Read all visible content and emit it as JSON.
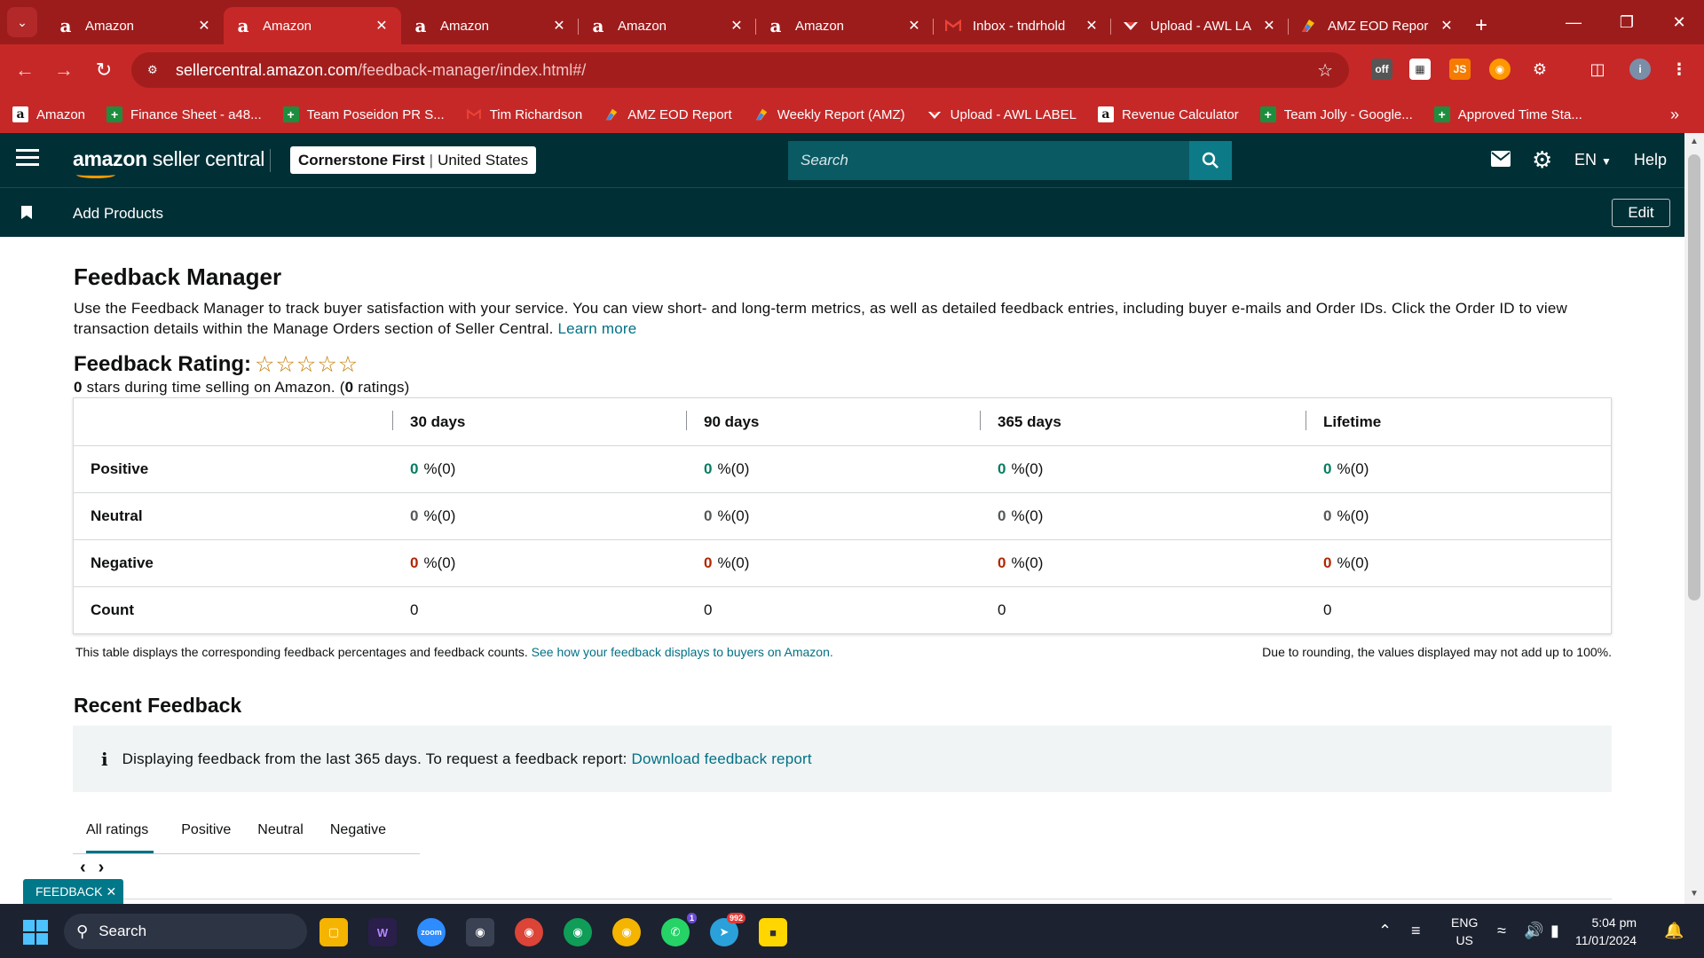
{
  "browser": {
    "tabs": [
      {
        "title": "Amazon",
        "icon": "amazon-icon",
        "active": false
      },
      {
        "title": "Amazon",
        "icon": "amazon-icon",
        "active": true
      },
      {
        "title": "Amazon",
        "icon": "amazon-icon",
        "active": false
      },
      {
        "title": "Amazon",
        "icon": "amazon-icon",
        "active": false
      },
      {
        "title": "Amazon",
        "icon": "amazon-icon",
        "active": false
      },
      {
        "title": "Inbox - tndrhold",
        "icon": "gmail-icon",
        "active": false
      },
      {
        "title": "Upload - AWL LA",
        "icon": "upload-icon",
        "active": false
      },
      {
        "title": "AMZ EOD Repor",
        "icon": "eod-report-icon",
        "active": false
      }
    ],
    "url_host": "sellercentral.amazon.com",
    "url_path": "/feedback-manager/index.html#/",
    "bookmarks": [
      {
        "label": "Amazon",
        "icon": "amazon-icon"
      },
      {
        "label": "Finance Sheet - a48...",
        "icon": "sheets-icon"
      },
      {
        "label": "Team Poseidon PR S...",
        "icon": "sheets-icon"
      },
      {
        "label": "Tim Richardson",
        "icon": "gmail-icon"
      },
      {
        "label": "AMZ EOD Report",
        "icon": "eod-report-icon"
      },
      {
        "label": "Weekly Report (AMZ)",
        "icon": "eod-report-icon"
      },
      {
        "label": "Upload - AWL LABEL",
        "icon": "upload-icon"
      },
      {
        "label": "Revenue Calculator",
        "icon": "amazon-icon"
      },
      {
        "label": "Team Jolly - Google...",
        "icon": "sheets-icon"
      },
      {
        "label": "Approved Time Sta...",
        "icon": "sheets-icon"
      }
    ],
    "accent_color": "#c62828"
  },
  "header": {
    "logo_text_bold": "amazon",
    "logo_text": " seller central",
    "store_name": "Cornerstone First",
    "store_region": "United States",
    "search_placeholder": "Search",
    "language": "EN",
    "help": "Help",
    "subnav_link": "Add Products",
    "edit_label": "Edit"
  },
  "page": {
    "title": "Feedback Manager",
    "description": "Use the Feedback Manager to track buyer satisfaction with your service. You can view short- and long-term metrics, as well as detailed feedback entries, including buyer e-mails and Order IDs. Click the Order ID to view transaction details within the Manage Orders section of Seller Central.",
    "learn_more": "Learn more",
    "rating_title": "Feedback Rating:",
    "rating_stars_filled": 0,
    "rating_stars_total": 5,
    "rating_sub_count": "0",
    "rating_sub_text": " stars during time selling on Amazon. (",
    "rating_sub_ratings": "0",
    "rating_sub_end": " ratings)"
  },
  "table": {
    "columns": [
      "30 days",
      "90 days",
      "365 days",
      "Lifetime"
    ],
    "rows": [
      {
        "label": "Positive",
        "cells": [
          {
            "num": "0",
            "pct": "%(0)"
          },
          {
            "num": "0",
            "pct": "%(0)"
          },
          {
            "num": "0",
            "pct": "%(0)"
          },
          {
            "num": "0",
            "pct": "%(0)"
          }
        ]
      },
      {
        "label": "Neutral",
        "cells": [
          {
            "num": "0",
            "pct": "%(0)"
          },
          {
            "num": "0",
            "pct": "%(0)"
          },
          {
            "num": "0",
            "pct": "%(0)"
          },
          {
            "num": "0",
            "pct": "%(0)"
          }
        ]
      },
      {
        "label": "Negative",
        "cells": [
          {
            "num": "0",
            "pct": "%(0)"
          },
          {
            "num": "0",
            "pct": "%(0)"
          },
          {
            "num": "0",
            "pct": "%(0)"
          },
          {
            "num": "0",
            "pct": "%(0)"
          }
        ]
      },
      {
        "label": "Count",
        "cells": [
          "0",
          "0",
          "0",
          "0"
        ]
      }
    ],
    "note_left": "This table displays the corresponding feedback percentages and feedback counts.",
    "note_left_link": "See how your feedback displays to buyers on Amazon.",
    "note_right": "Due to rounding, the values displayed may not add up to 100%.",
    "status_colors": {
      "positive": "#067d62",
      "neutral": "#565959",
      "negative": "#b12704"
    }
  },
  "recent": {
    "title": "Recent Feedback",
    "info_text": "Displaying feedback from the last 365 days. To request a feedback report:",
    "info_link": "Download feedback report",
    "tabs": [
      "All ratings",
      "Positive",
      "Neutral",
      "Negative"
    ],
    "active_tab": "All ratings",
    "feedback_tab": "FEEDBACK"
  },
  "taskbar": {
    "search_label": "Search",
    "lang_line1": "ENG",
    "lang_line2": "US",
    "time": "5:04 pm",
    "date": "11/01/2024",
    "whatsapp_badge": "1",
    "telegram_badge": "992"
  }
}
